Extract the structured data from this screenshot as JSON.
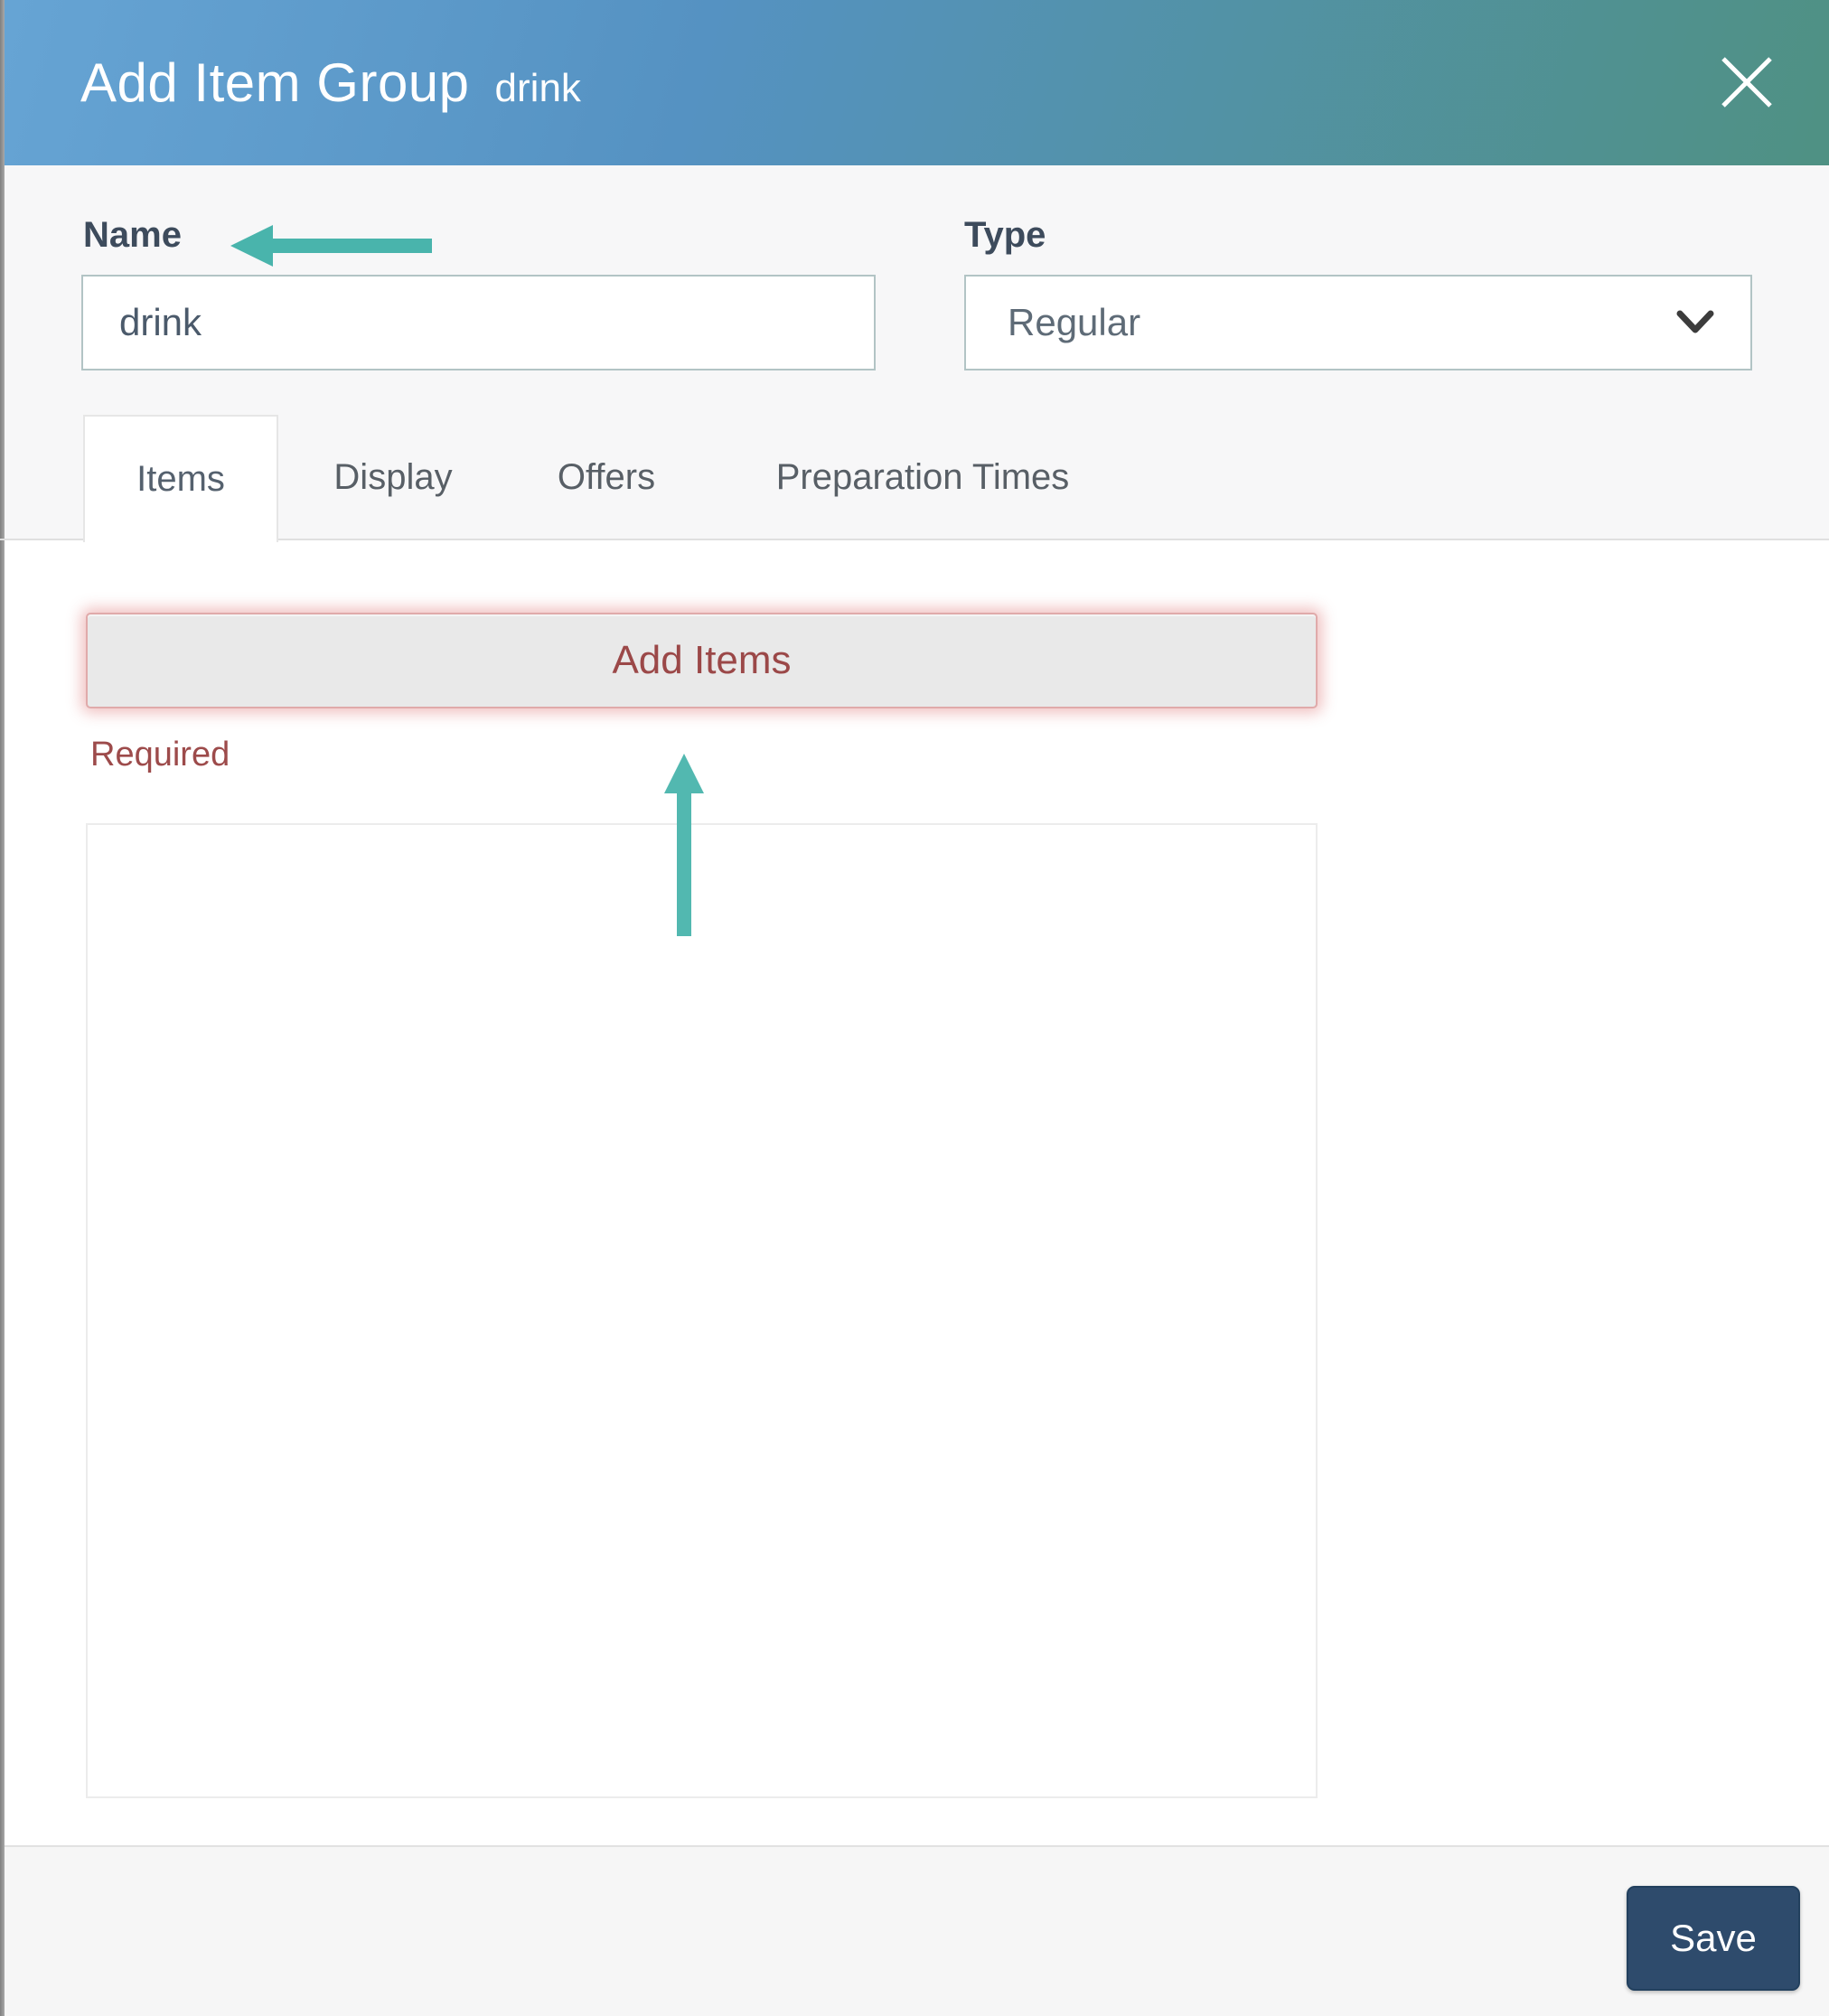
{
  "modal": {
    "title": "Add Item Group",
    "subtitle": "drink"
  },
  "form": {
    "name_field": {
      "label": "Name",
      "value": "drink"
    },
    "type_field": {
      "label": "Type",
      "value": "Regular"
    }
  },
  "tabs": [
    {
      "label": "Items",
      "active": true
    },
    {
      "label": "Display",
      "active": false
    },
    {
      "label": "Offers",
      "active": false
    },
    {
      "label": "Preparation Times",
      "active": false
    }
  ],
  "items_tab": {
    "add_items_label": "Add Items",
    "required_label": "Required"
  },
  "footer": {
    "save_label": "Save"
  },
  "colors": {
    "header_gradient_start": "#66a4d4",
    "header_gradient_end": "#4f9183",
    "annotation_teal": "#49b4ac",
    "danger_red": "#9b4848",
    "save_button_bg": "#2e4b6c",
    "form_bg": "#f7f7f8",
    "footer_bg": "#f6f6f6"
  }
}
